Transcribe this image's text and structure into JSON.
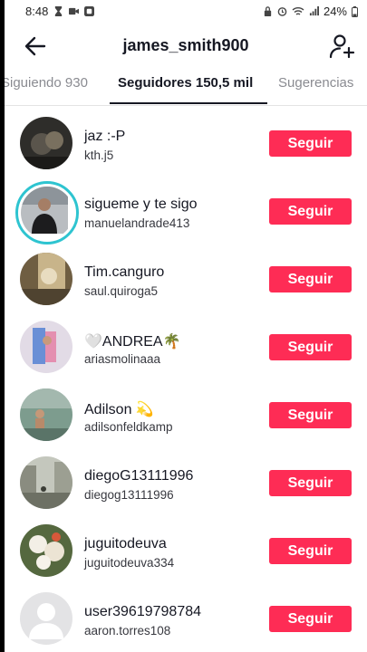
{
  "status_bar": {
    "time": "8:48",
    "battery": "24%"
  },
  "header": {
    "title": "james_smith900",
    "back_icon": "arrow-left-icon",
    "add_icon": "person-add-icon"
  },
  "tabs": [
    {
      "label": "Siguiendo 930",
      "active": false
    },
    {
      "label": "Seguidores 150,5 mil",
      "active": true
    },
    {
      "label": "Sugerencias",
      "active": false
    }
  ],
  "follow_label": "Seguir",
  "users": [
    {
      "name": "jaz :-P",
      "handle": "kth.j5",
      "avatar_color": "#3b3a36"
    },
    {
      "name": "sigueme y te sigo",
      "handle": "manuelandrade413",
      "avatar_color": "#8b8f93",
      "ring": true
    },
    {
      "name": "Tim.canguro",
      "handle": "saul.quiroga5",
      "avatar_color": "#9a8766"
    },
    {
      "name": "🤍ANDREA🌴",
      "handle": "ariasmolinaaa",
      "avatar_color": "#c9c2d6"
    },
    {
      "name": "Adilson 💫",
      "handle": "adilsonfeldkamp",
      "avatar_color": "#6f8a83"
    },
    {
      "name": "diegoG13111996",
      "handle": "diegog13111996",
      "avatar_color": "#a7a89a"
    },
    {
      "name": "juguitodeuva",
      "handle": "juguitodeuva334",
      "avatar_color": "#7c8a6a"
    },
    {
      "name": "user39619798784",
      "handle": "aaron.torres108",
      "avatar_color": "#e1e1e3",
      "default_avatar": true
    }
  ]
}
